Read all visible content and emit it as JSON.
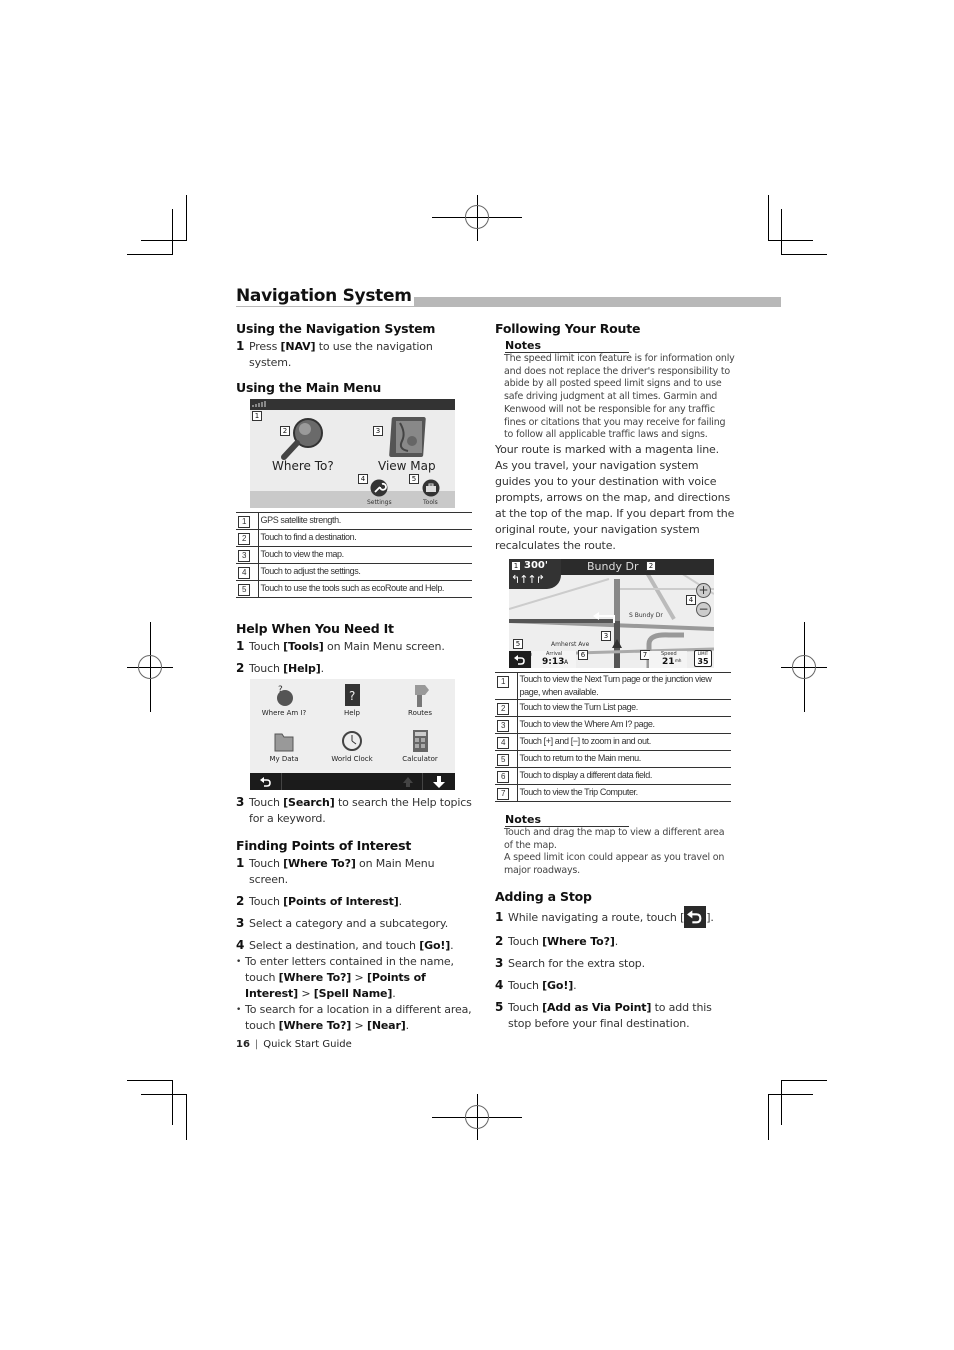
{
  "page": {
    "title": "Navigation System",
    "footer": {
      "page_number": "16",
      "guide_name": "Quick Start Guide"
    }
  },
  "left_column": {
    "using_nav": {
      "heading": "Using the Navigation System",
      "steps": [
        {
          "num": "1",
          "pre": "Press ",
          "bold": "[NAV]",
          "post": " to use the navigation system."
        }
      ]
    },
    "main_menu": {
      "heading": "Using the Main Menu",
      "screen": {
        "where_to": "Where To?",
        "view_map": "View Map",
        "settings": "Settings",
        "tools": "Tools",
        "callouts": [
          "1",
          "2",
          "3",
          "4",
          "5"
        ]
      },
      "legend": [
        {
          "idx": "1",
          "text": "GPS satellite strength."
        },
        {
          "idx": "2",
          "text": "Touch to find a destination."
        },
        {
          "idx": "3",
          "text": "Touch to view the map."
        },
        {
          "idx": "4",
          "text": "Touch to adjust the settings."
        },
        {
          "idx": "5",
          "text": "Touch to use the tools such as ecoRoute and Help."
        }
      ]
    },
    "help": {
      "heading": "Help When You Need It",
      "steps": [
        {
          "num": "1",
          "pre": "Touch ",
          "bold": "[Tools]",
          "post": " on Main Menu screen."
        },
        {
          "num": "2",
          "pre": "Touch ",
          "bold": "[Help]",
          "post": "."
        },
        {
          "num": "3",
          "pre": "Touch ",
          "bold": "[Search]",
          "post": " to search the Help topics for a keyword."
        }
      ],
      "screen": {
        "items": [
          "Where Am I?",
          "Help",
          "Routes",
          "My Data",
          "World Clock",
          "Calculator"
        ]
      }
    },
    "poi": {
      "heading": "Finding Points of Interest",
      "steps": [
        {
          "num": "1",
          "pre": "Touch ",
          "bold": "[Where To?]",
          "post": " on Main Menu screen."
        },
        {
          "num": "2",
          "pre": "Touch ",
          "bold": "[Points of Interest]",
          "post": "."
        },
        {
          "num": "3",
          "pre": "Select a category and a subcategory.",
          "bold": "",
          "post": ""
        },
        {
          "num": "4",
          "pre": "Select a destination, and touch ",
          "bold": "[Go!]",
          "post": "."
        }
      ],
      "bullets": [
        {
          "pre": "To enter letters contained in the name, touch ",
          "b1": "[Where To?]",
          "mid1": " > ",
          "b2": "[Points of Interest]",
          "mid2": " > ",
          "b3": "[Spell Name]",
          "post": "."
        },
        {
          "pre": "To search for a location in a different area, touch ",
          "b1": "[Where To?]",
          "mid1": " > ",
          "b2": "[Near]",
          "post": "."
        }
      ]
    }
  },
  "right_column": {
    "following": {
      "heading": "Following Your Route",
      "notes_label": "Notes",
      "notes_text": "The speed limit icon feature is for information only and does not replace the driver's responsibility to abide by all posted speed limit signs and to use safe driving judgment at all times. Garmin and Kenwood will not be responsible for any traffic fines or citations that you may receive for failing to follow all applicable traffic laws and signs.",
      "para1": "Your route is marked with a magenta line.",
      "para2": "As you travel, your navigation system guides you to your destination with voice prompts, arrows on the map, and directions at the top of the map. If you depart from the original route, your navigation system recalculates the route.",
      "map": {
        "distance": "300'",
        "street": "Bundy Dr",
        "cross_street": "S Bundy Dr",
        "side_street": "Amherst Ave",
        "arrival_label": "Arrival",
        "arrival_time": "9:13",
        "arrival_suffix": "A",
        "speed_label": "Speed",
        "speed_value": "21",
        "speed_unit": "mh",
        "limit_label": "LIMIT",
        "limit_value": "35",
        "callouts": [
          "1",
          "2",
          "3",
          "4",
          "5",
          "6",
          "7"
        ]
      },
      "legend": [
        {
          "idx": "1",
          "text": "Touch to view the Next Turn page or the junction view page, when available."
        },
        {
          "idx": "2",
          "text": "Touch to view the Turn List page."
        },
        {
          "idx": "3",
          "text": "Touch to view the Where Am I? page."
        },
        {
          "idx": "4",
          "text": "Touch [+] and [−] to zoom in and out."
        },
        {
          "idx": "5",
          "text": "Touch to return to the Main menu."
        },
        {
          "idx": "6",
          "text": "Touch to display a different data field."
        },
        {
          "idx": "7",
          "text": "Touch to view the Trip Computer."
        }
      ],
      "notes2_label": "Notes",
      "notes2_lines": [
        "Touch and drag the map to view a different area of the map.",
        "A speed limit icon could appear as you travel on major roadways."
      ]
    },
    "adding_stop": {
      "heading": "Adding a Stop",
      "steps": [
        {
          "num": "1",
          "pre": "While navigating a route, touch [",
          "bold": "",
          "post": "]."
        },
        {
          "num": "2",
          "pre": "Touch ",
          "bold": "[Where To?]",
          "post": "."
        },
        {
          "num": "3",
          "pre": "Search for the extra stop.",
          "bold": "",
          "post": ""
        },
        {
          "num": "4",
          "pre": "Touch ",
          "bold": "[Go!]",
          "post": "."
        },
        {
          "num": "5",
          "pre": "Touch ",
          "bold": "[Add as Via Point]",
          "post": " to add this stop before your final destination."
        }
      ]
    }
  }
}
